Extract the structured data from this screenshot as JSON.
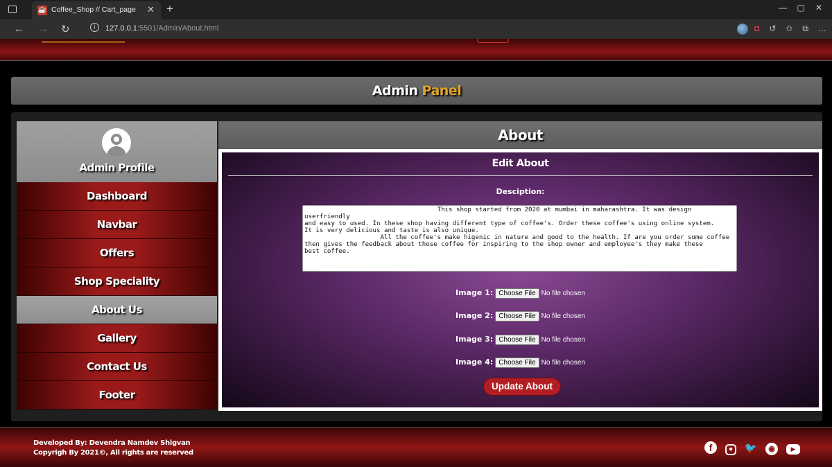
{
  "browser": {
    "tab_title": "Coffee_Shop // Cart_page",
    "url_host": "127.0.0.1",
    "url_path": ":5501/Admin/About.html"
  },
  "header": {
    "title_main": "Admin",
    "title_accent": "Panel"
  },
  "sidebar": {
    "profile_label": "Admin Profile",
    "items": [
      {
        "label": "Dashboard",
        "active": false
      },
      {
        "label": "Navbar",
        "active": false
      },
      {
        "label": "Offers",
        "active": false
      },
      {
        "label": "Shop Speciality",
        "active": false
      },
      {
        "label": "About Us",
        "active": true
      },
      {
        "label": "Gallery",
        "active": false
      },
      {
        "label": "Contact Us",
        "active": false
      },
      {
        "label": "Footer",
        "active": false
      }
    ]
  },
  "main": {
    "title": "About",
    "form_title": "Edit About",
    "description_label": "Desciption:",
    "description_value": "                                   This shop started from 2020 at mumbai in maharashtra. It was design userfriendly\nand easy to used. In these shop having different type of coffee's. Order these coffee's using online system.\nIt is very delicious and taste is also unique.\n                    All the coffee's make higenic in nature and good to the health. If are you order some coffee\nthen gives the feedback about those coffee for inspiring to the shop owner and employee's they make these\nbest coffee.",
    "images": [
      {
        "label": "Image 1:",
        "button": "Choose File",
        "status": "No file chosen"
      },
      {
        "label": "Image 2:",
        "button": "Choose File",
        "status": "No file chosen"
      },
      {
        "label": "Image 3:",
        "button": "Choose File",
        "status": "No file chosen"
      },
      {
        "label": "Image 4:",
        "button": "Choose File",
        "status": "No file chosen"
      }
    ],
    "update_button": "Update About"
  },
  "footer": {
    "developer": "Developed By: Devendra Namdev Shigvan",
    "copyright": "Copyrigh By 2021©, All rights are reserved",
    "social_icons": [
      "facebook-icon",
      "instagram-icon",
      "twitter-icon",
      "github-icon",
      "youtube-icon"
    ]
  },
  "colors": {
    "accent": "#e0a52a",
    "brand_red": "#9a1a1a",
    "button_red": "#b21e23",
    "panel_purple": "#5e2a6a"
  }
}
